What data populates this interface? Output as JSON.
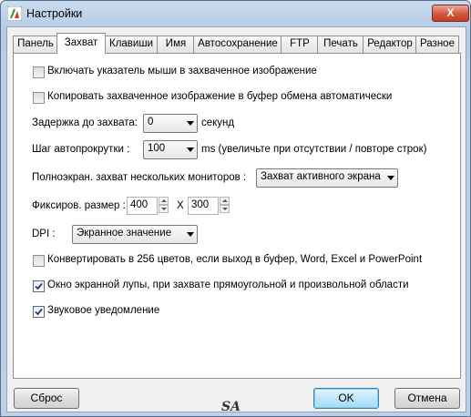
{
  "window": {
    "title": "Настройки",
    "close_glyph": "X"
  },
  "tabs": [
    {
      "label": "Панель"
    },
    {
      "label": "Захват"
    },
    {
      "label": "Клавиши"
    },
    {
      "label": "Имя"
    },
    {
      "label": "Автосохранение"
    },
    {
      "label": "FTP"
    },
    {
      "label": "Печать"
    },
    {
      "label": "Редактор"
    },
    {
      "label": "Разное"
    }
  ],
  "active_tab": "Захват",
  "capture": {
    "include_cursor": {
      "label": "Включать указатель мыши в захваченное изображение",
      "checked": false
    },
    "copy_clipboard": {
      "label": "Копировать захваченное изображение в буфер обмена автоматически",
      "checked": false
    },
    "delay": {
      "label": "Задержка до захвата:",
      "value": "0",
      "unit": "секунд"
    },
    "scroll_step": {
      "label": "Шаг автопрокрутки :",
      "value": "100",
      "unit": "ms (увеличьте при отсутствии / повторе строк)"
    },
    "multimonitor": {
      "label": "Полноэкран. захват нескольких мониторов :",
      "value": "Захват активного экрана"
    },
    "fixed_size": {
      "label": "Фиксиров. размер :",
      "width": "400",
      "sep": "X",
      "height": "300"
    },
    "dpi": {
      "label": "DPI :",
      "value": "Экранное значение"
    },
    "convert256": {
      "label": "Конвертировать в 256 цветов, если выход в буфер, Word, Excel и PowerPoint",
      "checked": false
    },
    "magnifier": {
      "label": "Окно экранной лупы, при захвате прямоугольной и произвольной области",
      "checked": true
    },
    "sound": {
      "label": "Звуковое уведомление",
      "checked": true
    }
  },
  "buttons": {
    "reset": "Сброс",
    "ok": "OK",
    "cancel": "Отмена"
  },
  "logo_text": "SA"
}
